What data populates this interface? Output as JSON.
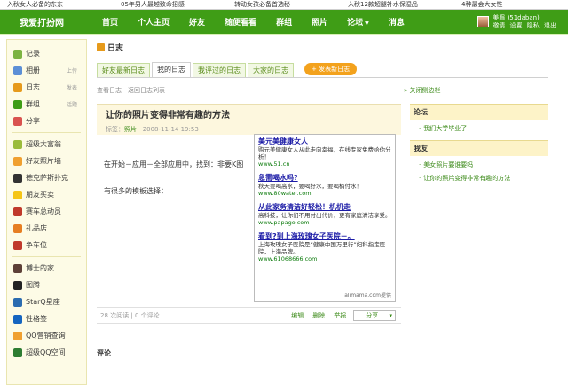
{
  "ticker": [
    "入秋女人必备的东东",
    "05年男人最越致命招感",
    "转动女孩必备首选秘",
    "入秋12款超腿补水保湿品",
    "4种最会大女性"
  ],
  "header": {
    "logo": "我爱打扮网",
    "nav": [
      "首页",
      "个人主页",
      "好友",
      "随便看看",
      "群组",
      "照片",
      "论坛",
      "消息"
    ],
    "user_name": "美眉 (51daban)",
    "user_links": [
      "邀请",
      "设置",
      "隐私",
      "退出"
    ]
  },
  "sidebar": [
    {
      "label": "记录",
      "extra": "",
      "color": "#7cb342"
    },
    {
      "label": "相册",
      "extra": "上传",
      "color": "#5c8fd6"
    },
    {
      "label": "日志",
      "extra": "发表",
      "color": "#e69a1b"
    },
    {
      "label": "群组",
      "extra": "话题",
      "color": "#3f9d16"
    },
    {
      "label": "分享",
      "extra": "",
      "color": "#d9534f"
    },
    {
      "label": "超级大富翁",
      "extra": "",
      "color": "#9bbc3c"
    },
    {
      "label": "好友照片墙",
      "extra": "",
      "color": "#f0a030"
    },
    {
      "label": "德克萨斯扑克",
      "extra": "",
      "color": "#333333"
    },
    {
      "label": "朋友买卖",
      "extra": "",
      "color": "#f5c518"
    },
    {
      "label": "赛车总动员",
      "extra": "",
      "color": "#c0392b"
    },
    {
      "label": "礼品店",
      "extra": "",
      "color": "#e67e22"
    },
    {
      "label": "争车位",
      "extra": "",
      "color": "#c0392b"
    },
    {
      "label": "博士的家",
      "extra": "",
      "color": "#5d4037"
    },
    {
      "label": "图腾",
      "extra": "",
      "color": "#222222"
    },
    {
      "label": "StarQ星座",
      "extra": "",
      "color": "#2b6cb0"
    },
    {
      "label": "性格签",
      "extra": "",
      "color": "#1565c0"
    },
    {
      "label": "QQ营销查询",
      "extra": "",
      "color": "#f0a030"
    },
    {
      "label": "超级QQ空间",
      "extra": "",
      "color": "#2e7d32"
    }
  ],
  "page": {
    "title": "日志",
    "tabs": [
      "好友最新日志",
      "我的日志",
      "我评过的日志",
      "大家的日志"
    ],
    "new_button": "+ 发表新日志",
    "crumbs": [
      "查看日志",
      "返回日志列表"
    ],
    "crumb_right": "» 关闭侧边栏"
  },
  "article": {
    "title": "让你的照片变得非常有趣的方法",
    "tag": "标签：",
    "tag_value": "照片",
    "date": "2008-11-14 19:53",
    "paragraphs": [
      "在开始－应用－全部应用中，找到：非要K图",
      "有很多的模板选择："
    ],
    "views": "28 次阅读",
    "comments": "0 个评论",
    "actions": [
      "编辑",
      "删除",
      "举报"
    ],
    "share": "分享"
  },
  "ad": [
    {
      "head": "美元美健康女人",
      "body": "购元美健康女人从此走向幸福，在线专家免费给你分析！",
      "url": "www.51.cn"
    },
    {
      "head": "急需喝水吗?",
      "body": "秋天要喝高水，要喝好水，要喝桶付水！",
      "url": "www.80water.com"
    },
    {
      "head": "从此家务清洁好轻松！机机走",
      "body": "高科技，让你们不用付出代价，更有家庭清洁享受。",
      "url": "www.papago.com"
    },
    {
      "head": "看到?到上海玫瑰女子医院－。",
      "body": "上海玫瑰女子医院是“健康中国万里行”妇科指定医院，上海品牌。",
      "url": "www.61068666.com"
    }
  ],
  "ad_footer": "alimama.com提供",
  "comments_title": "评论",
  "right": {
    "forum_title": "论坛",
    "forum_items": [
      "我们大学毕业了"
    ],
    "friends_title": "我友",
    "friends_items": [
      "美女照片要谁要吗",
      "让你的照片变得非常有趣的方法"
    ]
  }
}
